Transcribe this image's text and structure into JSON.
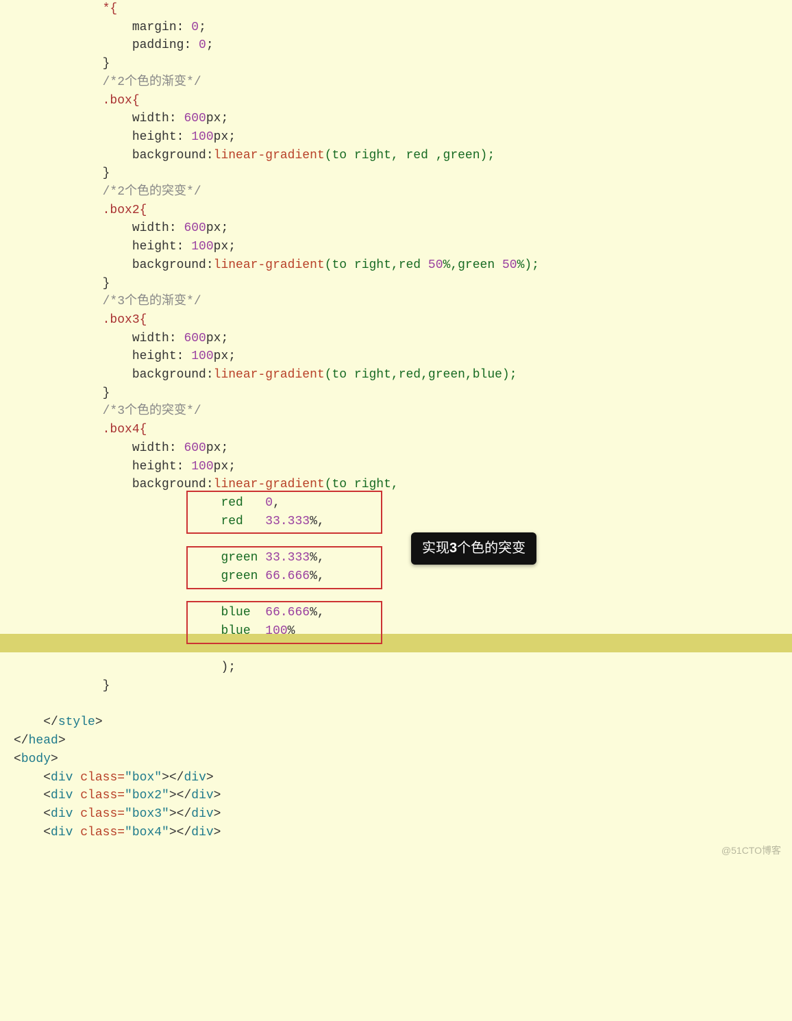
{
  "code": {
    "l01": "            *{",
    "l02a": "                margin: ",
    "l02b": "0",
    "l02c": ";",
    "l03a": "                padding: ",
    "l03b": "0",
    "l03c": ";",
    "l04": "            }",
    "c1": "            /*2个色的渐变*/",
    "l05": "            .box{",
    "l06a": "                width: ",
    "l06b": "600",
    "l06c": "px;",
    "l07a": "                height: ",
    "l07b": "100",
    "l07c": "px;",
    "l08a": "                background:",
    "l08b": "linear-gradient",
    "l08c": "(to right, red ,green);",
    "l09": "            }",
    "c2": "            /*2个色的突变*/",
    "l10": "            .box2{",
    "l11a": "                width: ",
    "l11b": "600",
    "l11c": "px;",
    "l12a": "                height: ",
    "l12b": "100",
    "l12c": "px;",
    "l13a": "                background:",
    "l13b": "linear-gradient",
    "l13c": "(to right,red ",
    "l13d": "50",
    "l13e": "%,green ",
    "l13f": "50",
    "l13g": "%);",
    "l14": "            }",
    "c3": "            /*3个色的渐变*/",
    "l15": "            .box3{",
    "l16a": "                width: ",
    "l16b": "600",
    "l16c": "px;",
    "l17a": "                height: ",
    "l17b": "100",
    "l17c": "px;",
    "l18a": "                background:",
    "l18b": "linear-gradient",
    "l18c": "(to right,red,green,blue);",
    "l19": "            }",
    "c4": "            /*3个色的突变*/",
    "l20": "            .box4{",
    "l21a": "                width: ",
    "l21b": "600",
    "l21c": "px;",
    "l22a": "                height: ",
    "l22b": "100",
    "l22c": "px;",
    "l23a": "                background:",
    "l23b": "linear-gradient",
    "l23c": "(to right,",
    "l24a": "                            red   ",
    "l24b": "0",
    "l24c": ",",
    "l25a": "                            red   ",
    "l25b": "33.333",
    "l25c": "%,",
    "blank1": " ",
    "l26a": "                            green ",
    "l26b": "33.333",
    "l26c": "%,",
    "l27a": "                            green ",
    "l27b": "66.666",
    "l27c": "%,",
    "blank2": " ",
    "l28a": "                            blue  ",
    "l28b": "66.666",
    "l28c": "%,",
    "l29a": "                            blue  ",
    "l29b": "100",
    "l29c": "%",
    "blank3": " ",
    "l30": "                            );",
    "l31": "            }",
    "blank4": " ",
    "l32a": "    </",
    "l32b": "style",
    "l32c": ">",
    "l33a": "</",
    "l33b": "head",
    "l33c": ">",
    "l34a": "<",
    "l34b": "body",
    "l34c": ">",
    "l35a": "    <",
    "l35b": "div ",
    "l35attr": "class=",
    "l35str": "\"box\"",
    "l35c": "></",
    "l35d": "div",
    "l35e": ">",
    "l36a": "    <",
    "l36b": "div ",
    "l36attr": "class=",
    "l36str": "\"box2\"",
    "l36c": "></",
    "l36d": "div",
    "l36e": ">",
    "l37a": "    <",
    "l37b": "div ",
    "l37attr": "class=",
    "l37str": "\"box3\"",
    "l37c": "></",
    "l37d": "div",
    "l37e": ">",
    "l38a": "    <",
    "l38b": "div ",
    "l38attr": "class=",
    "l38str": "\"box4\"",
    "l38c": "></",
    "l38d": "div",
    "l38e": ">"
  },
  "callout": {
    "prefix": "实现",
    "bold": "3",
    "suffix": "个色的突变"
  },
  "watermark": "@51CTO博客"
}
